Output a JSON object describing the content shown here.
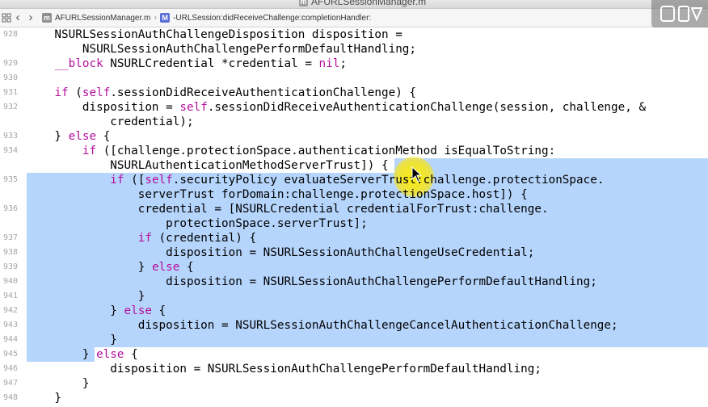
{
  "window": {
    "title": "AFURLSessionManager.m",
    "file_badge": "m"
  },
  "jumpbar": {
    "file_badge": "m",
    "file": "AFURLSessionManager.m",
    "method_badge": "M",
    "method": "-URLSession:didReceiveChallenge:completionHandler:",
    "back_glyph": "‹",
    "forward_glyph": "›",
    "separator": "›"
  },
  "colors": {
    "keyword": "#b40f9c",
    "selection": "#b6d5fc",
    "highlight": "#ffe600",
    "line_number": "#a6a6a6"
  },
  "editor": {
    "lines": [
      {
        "num": "928",
        "segments": [
          {
            "text": "    NSURLSessionAuthChallengeDisposition disposition =",
            "k": false
          }
        ]
      },
      {
        "num": "",
        "segments": [
          {
            "text": "        NSURLSessionAuthChallengePerformDefaultHandling;",
            "k": false
          }
        ]
      },
      {
        "num": "929",
        "segments": [
          {
            "text": "    ",
            "k": false
          },
          {
            "text": "__block",
            "k": true
          },
          {
            "text": " NSURLCredential *credential = ",
            "k": false
          },
          {
            "text": "nil",
            "k": true
          },
          {
            "text": ";",
            "k": false
          }
        ]
      },
      {
        "num": "930",
        "segments": []
      },
      {
        "num": "931",
        "segments": [
          {
            "text": "    ",
            "k": false
          },
          {
            "text": "if",
            "k": true
          },
          {
            "text": " (",
            "k": false
          },
          {
            "text": "self",
            "k": true
          },
          {
            "text": ".sessionDidReceiveAuthenticationChallenge) {",
            "k": false
          }
        ]
      },
      {
        "num": "932",
        "segments": [
          {
            "text": "        disposition = ",
            "k": false
          },
          {
            "text": "self",
            "k": true
          },
          {
            "text": ".sessionDidReceiveAuthenticationChallenge(session, challenge, &",
            "k": false
          }
        ]
      },
      {
        "num": "",
        "segments": [
          {
            "text": "            credential);",
            "k": false
          }
        ]
      },
      {
        "num": "933",
        "segments": [
          {
            "text": "    } ",
            "k": false
          },
          {
            "text": "else",
            "k": true
          },
          {
            "text": " {",
            "k": false
          }
        ]
      },
      {
        "num": "934",
        "segments": [
          {
            "text": "        ",
            "k": false
          },
          {
            "text": "if",
            "k": true
          },
          {
            "text": " ([challenge.protectionSpace.authenticationMethod isEqualToString:",
            "k": false
          }
        ]
      },
      {
        "num": "",
        "segments": [
          {
            "text": "            NSURLAuthenticationMethodServerTrust]) {",
            "k": false
          }
        ]
      },
      {
        "num": "935",
        "segments": [
          {
            "text": "            ",
            "k": false
          },
          {
            "text": "if",
            "k": true
          },
          {
            "text": " ([",
            "k": false
          },
          {
            "text": "self",
            "k": true
          },
          {
            "text": ".securityPolicy evaluateServerTrust:challenge.protectionSpace.",
            "k": false
          }
        ]
      },
      {
        "num": "",
        "segments": [
          {
            "text": "                serverTrust forDomain:challenge.protectionSpace.host]) {",
            "k": false
          }
        ]
      },
      {
        "num": "936",
        "segments": [
          {
            "text": "                credential = [NSURLCredential credentialForTrust:challenge.",
            "k": false
          }
        ]
      },
      {
        "num": "",
        "segments": [
          {
            "text": "                    protectionSpace.serverTrust];",
            "k": false
          }
        ]
      },
      {
        "num": "937",
        "segments": [
          {
            "text": "                ",
            "k": false
          },
          {
            "text": "if",
            "k": true
          },
          {
            "text": " (credential) {",
            "k": false
          }
        ]
      },
      {
        "num": "938",
        "segments": [
          {
            "text": "                    disposition = NSURLSessionAuthChallengeUseCredential;",
            "k": false
          }
        ]
      },
      {
        "num": "939",
        "segments": [
          {
            "text": "                } ",
            "k": false
          },
          {
            "text": "else",
            "k": true
          },
          {
            "text": " {",
            "k": false
          }
        ]
      },
      {
        "num": "940",
        "segments": [
          {
            "text": "                    disposition = NSURLSessionAuthChallengePerformDefaultHandling;",
            "k": false
          }
        ]
      },
      {
        "num": "941",
        "segments": [
          {
            "text": "                }",
            "k": false
          }
        ]
      },
      {
        "num": "942",
        "segments": [
          {
            "text": "            } ",
            "k": false
          },
          {
            "text": "else",
            "k": true
          },
          {
            "text": " {",
            "k": false
          }
        ]
      },
      {
        "num": "943",
        "segments": [
          {
            "text": "                disposition = NSURLSessionAuthChallengeCancelAuthenticationChallenge;",
            "k": false
          }
        ]
      },
      {
        "num": "944",
        "segments": [
          {
            "text": "            }",
            "k": false
          }
        ]
      },
      {
        "num": "945",
        "segments": [
          {
            "text": "        } ",
            "k": false
          },
          {
            "text": "else",
            "k": true
          },
          {
            "text": " {",
            "k": false
          }
        ]
      },
      {
        "num": "946",
        "segments": [
          {
            "text": "            disposition = NSURLSessionAuthChallengePerformDefaultHandling;",
            "k": false
          }
        ]
      },
      {
        "num": "947",
        "segments": [
          {
            "text": "        }",
            "k": false
          }
        ]
      },
      {
        "num": "948",
        "segments": [
          {
            "text": "    }",
            "k": false
          }
        ]
      }
    ]
  }
}
